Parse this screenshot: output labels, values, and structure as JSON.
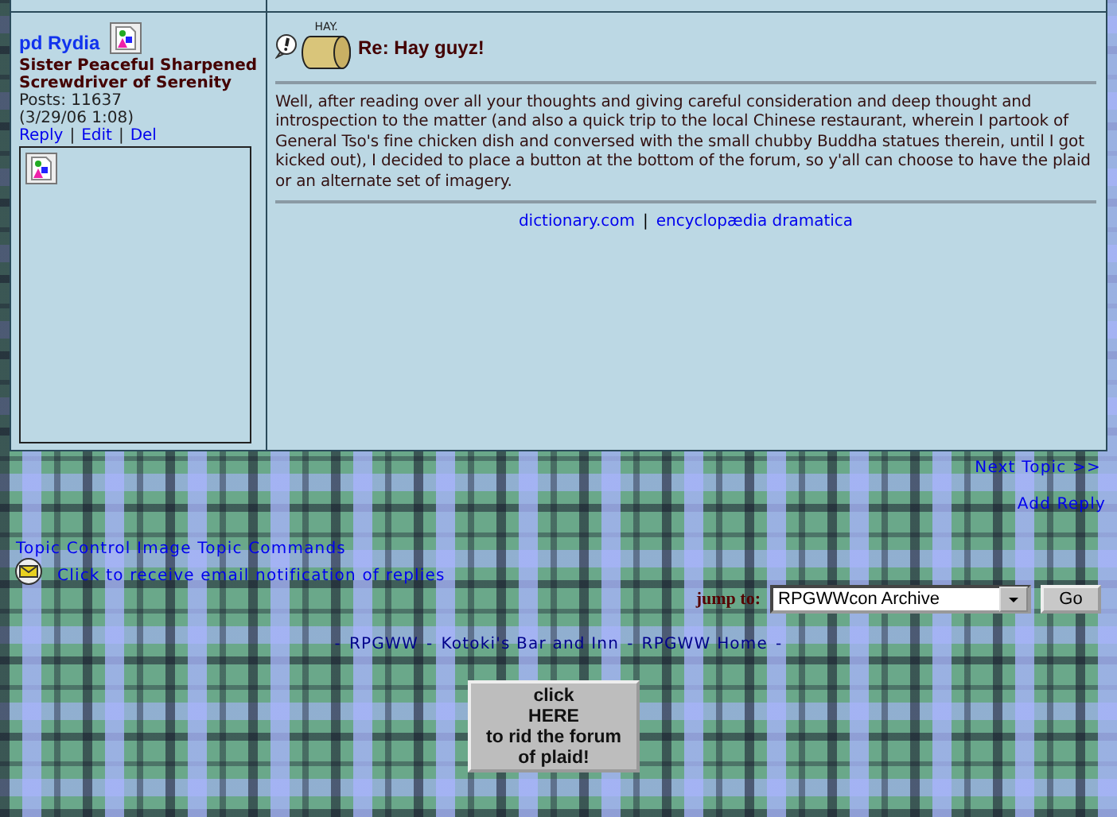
{
  "post": {
    "author": "pd Rydia",
    "author_title": "Sister Peaceful Sharpened Screwdriver of Serenity",
    "posts": "Posts: 11637",
    "date": "(3/29/06 1:08)",
    "actions": [
      "Reply",
      "Edit",
      "Del"
    ],
    "separator": "|",
    "subject": "Re: Hay guyz!",
    "hay_label": "HAY.",
    "body": "Well, after reading over all your thoughts and giving careful consideration and deep thought and introspection to the matter (and also a quick trip to the local Chinese restaurant, wherein I partook of General Tso's fine chicken dish and conversed with the small chubby Buddha statues therein, until I got kicked out), I decided to place a button at the bottom of the forum, so y'all can choose to have the plaid or an alternate set of imagery.",
    "signature_links": [
      "dictionary.com",
      "encyclopædia dramatica"
    ]
  },
  "nav": {
    "next_topic": "Next Topic >>",
    "add_reply": "Add Reply",
    "topic_control": "Topic Control Image Topic Commands",
    "email_notify": "Click to receive email notification of replies"
  },
  "jump": {
    "label": "jump to:",
    "value": "RPGWWcon Archive",
    "button": "Go"
  },
  "footer": {
    "separator": "-",
    "links": [
      "RPGWW",
      "Kotoki's Bar and Inn",
      "RPGWW Home"
    ]
  },
  "plaid_button": [
    "click",
    "HERE",
    "to rid the forum",
    "of plaid!"
  ]
}
